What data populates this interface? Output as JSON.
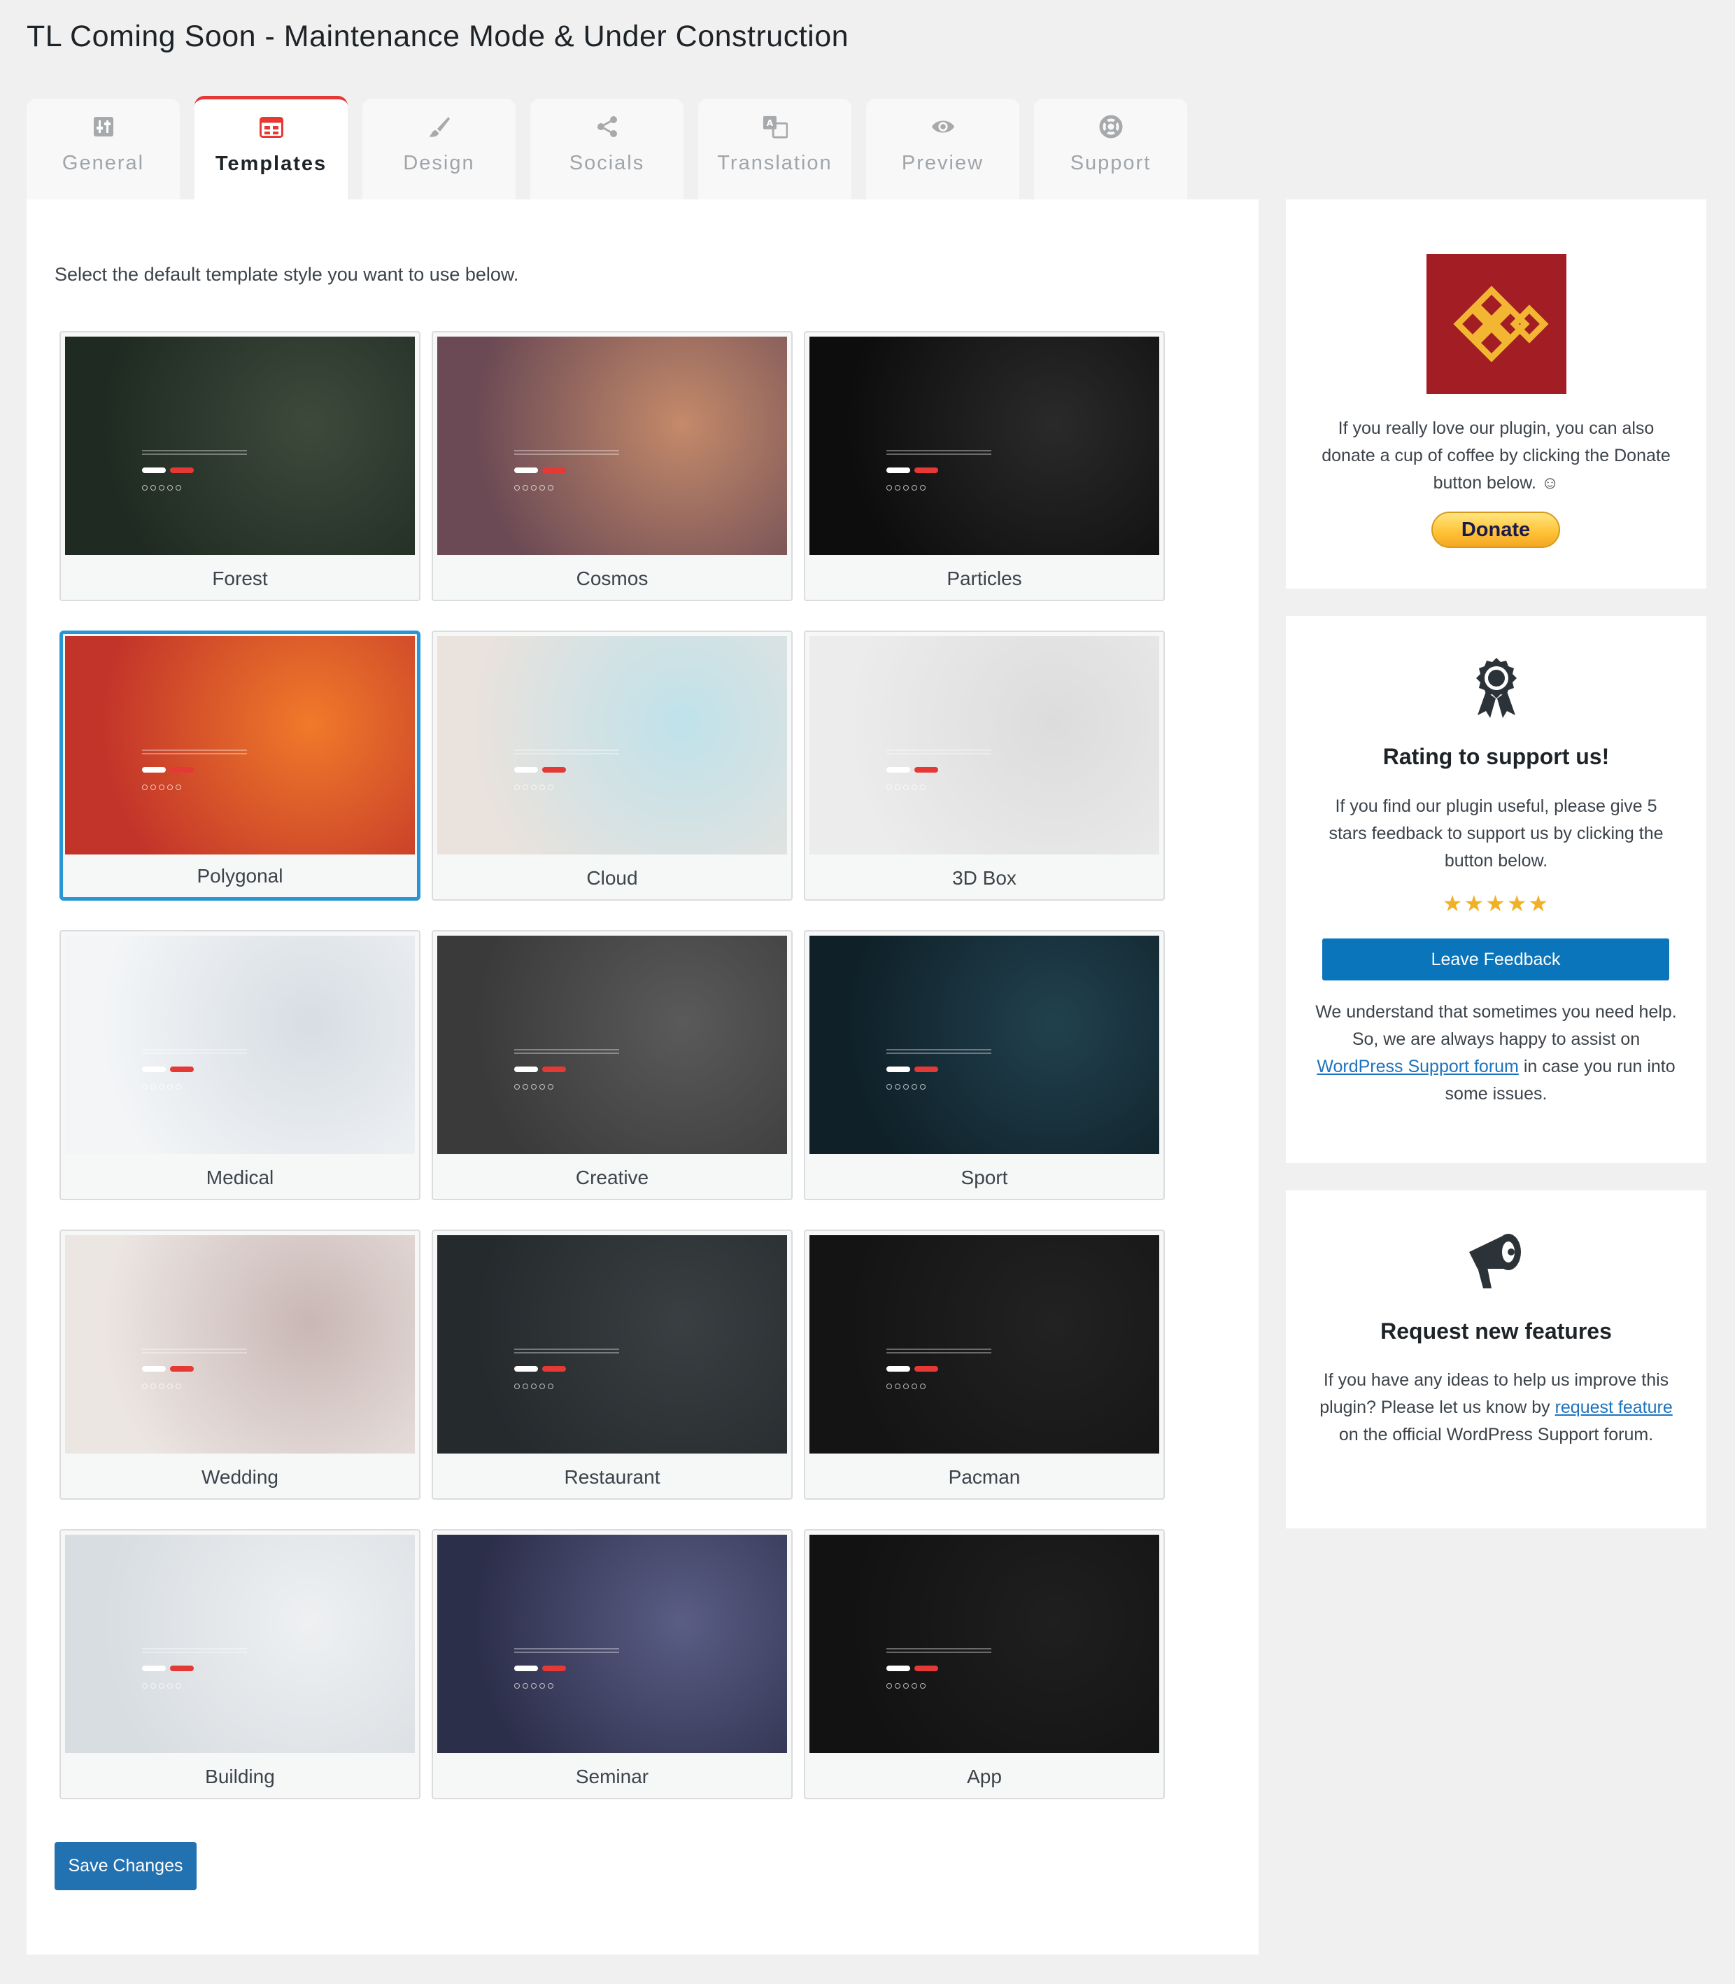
{
  "page": {
    "title": "TL Coming Soon - Maintenance Mode & Under Construction"
  },
  "tabs": [
    {
      "label": "General",
      "icon": "sliders-icon"
    },
    {
      "label": "Templates",
      "icon": "templates-icon",
      "active": true
    },
    {
      "label": "Design",
      "icon": "brush-icon"
    },
    {
      "label": "Socials",
      "icon": "share-icon"
    },
    {
      "label": "Translation",
      "icon": "translate-icon"
    },
    {
      "label": "Preview",
      "icon": "eye-icon"
    },
    {
      "label": "Support",
      "icon": "lifebuoy-icon"
    }
  ],
  "main": {
    "intro": "Select the default template style you want to use below.",
    "selected_template": "Polygonal",
    "save_label": "Save Changes"
  },
  "templates": [
    {
      "name": "Forest",
      "bg": "#1f2a22",
      "accent": "#3d4a3b"
    },
    {
      "name": "Cosmos",
      "bg": "#6b4a55",
      "accent": "#c48a6a"
    },
    {
      "name": "Particles",
      "bg": "#0d0d0d",
      "accent": "#2a2a2a"
    },
    {
      "name": "Polygonal",
      "bg": "#c2342a",
      "accent": "#f07a2a"
    },
    {
      "name": "Cloud",
      "bg": "#e9e2dd",
      "accent": "#bfe2ea"
    },
    {
      "name": "3D Box",
      "bg": "#ececec",
      "accent": "#dcdcdc"
    },
    {
      "name": "Medical",
      "bg": "#f3f5f7",
      "accent": "#d7dde3"
    },
    {
      "name": "Creative",
      "bg": "#3a3a3a",
      "accent": "#5a5a5a"
    },
    {
      "name": "Sport",
      "bg": "#0f2028",
      "accent": "#21414e"
    },
    {
      "name": "Wedding",
      "bg": "#ece6e3",
      "accent": "#c9b7b4"
    },
    {
      "name": "Restaurant",
      "bg": "#252a2d",
      "accent": "#3a3f42"
    },
    {
      "name": "Pacman",
      "bg": "#141414",
      "accent": "#222222"
    },
    {
      "name": "Building",
      "bg": "#d8dde1",
      "accent": "#eef0f2"
    },
    {
      "name": "Seminar",
      "bg": "#2c2f4a",
      "accent": "#5a5d85"
    },
    {
      "name": "App",
      "bg": "#121212",
      "accent": "#1f1f1f"
    }
  ],
  "sidebar": {
    "donate": {
      "text": "If you really love our plugin, you can also donate a cup of coffee by clicking the Donate button below. ☺",
      "button": "Donate",
      "logo_color": "#a31d24",
      "knot_color": "#f2b632"
    },
    "rating": {
      "heading": "Rating to support us!",
      "text": "If you find our plugin useful, please give 5 stars feedback to support us by clicking the button below.",
      "stars": "★★★★★",
      "button": "Leave Feedback",
      "help_before": "We understand that sometimes you need help. So, we are always happy to assist on ",
      "help_link": "WordPress Support forum",
      "help_after": " in case you run into some issues."
    },
    "request": {
      "heading": "Request new features",
      "text_before": "If you have any ideas to help us improve this plugin? Please let us know by ",
      "link": "request feature",
      "text_after": " on the official WordPress Support forum."
    }
  }
}
